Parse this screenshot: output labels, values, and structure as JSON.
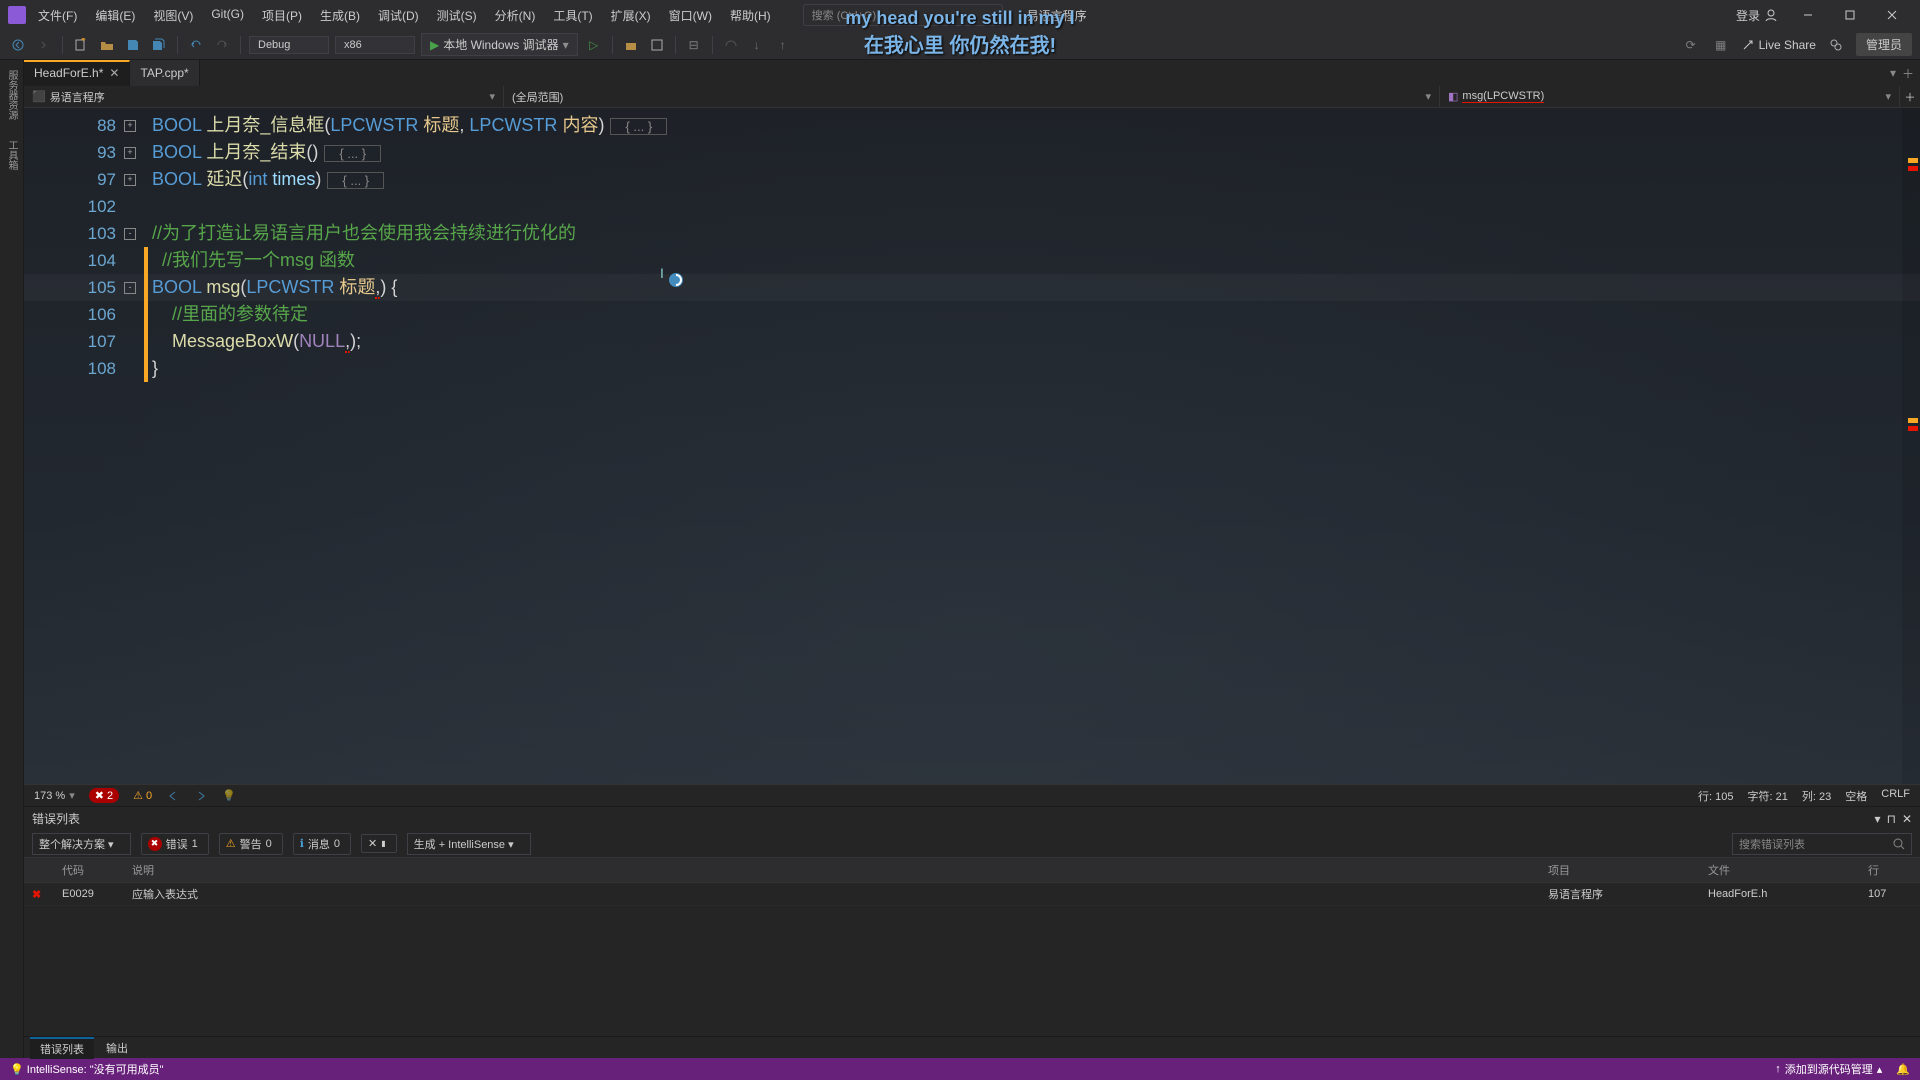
{
  "titlebar": {
    "menus": [
      "文件(F)",
      "编辑(E)",
      "视图(V)",
      "Git(G)",
      "项目(P)",
      "生成(B)",
      "调试(D)",
      "测试(S)",
      "分析(N)",
      "工具(T)",
      "扩展(X)",
      "窗口(W)",
      "帮助(H)"
    ],
    "search_placeholder": "搜索 (Ctrl+Q)",
    "project": "易语言程序",
    "login": "登录",
    "admin": "管理员"
  },
  "lyrics": {
    "en": "my head you're still in my l",
    "cn": "在我心里 你仍然在我!"
  },
  "toolbar": {
    "config": "Debug",
    "platform": "x86",
    "run": "本地 Windows 调试器",
    "liveshare": "Live Share"
  },
  "tabs": [
    {
      "name": "HeadForE.h*",
      "active": true
    },
    {
      "name": "TAP.cpp*",
      "active": false
    }
  ],
  "navbar": {
    "scope_icon": "cpp",
    "scope_left": "易语言程序",
    "scope_center": "(全局范围)",
    "scope_right": "msg(LPCWSTR)"
  },
  "code_lines": [
    {
      "n": 88,
      "fold": "+",
      "bar": "",
      "tokens": [
        [
          "k-type",
          "BOOL "
        ],
        [
          "k-func",
          "上月奈_信息框"
        ],
        [
          "k-punct",
          "("
        ],
        [
          "k-keyword",
          "LPCWSTR"
        ],
        [
          "k-title",
          " 标题"
        ],
        [
          "k-punct",
          ", "
        ],
        [
          "k-keyword",
          "LPCWSTR"
        ],
        [
          "k-title",
          " 内容"
        ],
        [
          "k-punct",
          ")"
        ]
      ],
      "ellipsis": true
    },
    {
      "n": 93,
      "fold": "+",
      "bar": "",
      "tokens": [
        [
          "k-type",
          "BOOL "
        ],
        [
          "k-func",
          "上月奈_结束"
        ],
        [
          "k-punct",
          "()"
        ]
      ],
      "ellipsis": true
    },
    {
      "n": 97,
      "fold": "+",
      "bar": "",
      "tokens": [
        [
          "k-type",
          "BOOL "
        ],
        [
          "k-func",
          "延迟"
        ],
        [
          "k-punct",
          "("
        ],
        [
          "k-keyword",
          "int"
        ],
        [
          "k-param",
          " times"
        ],
        [
          "k-punct",
          ")"
        ]
      ],
      "ellipsis": true
    },
    {
      "n": 102,
      "fold": "",
      "bar": "",
      "tokens": []
    },
    {
      "n": 103,
      "fold": "-",
      "bar": "",
      "tokens": [
        [
          "k-comment",
          "//为了打造让易语言用户也会使用我会持续进行优化的"
        ]
      ]
    },
    {
      "n": 104,
      "fold": "",
      "bar": "mod",
      "tokens": [
        [
          "",
          "  "
        ],
        [
          "k-comment",
          "//我们先写一个msg 函数"
        ]
      ]
    },
    {
      "n": 105,
      "fold": "-",
      "bar": "mod",
      "hl": true,
      "tokens": [
        [
          "k-type",
          "BOOL "
        ],
        [
          "k-func",
          "msg"
        ],
        [
          "k-punct",
          "("
        ],
        [
          "k-keyword",
          "LPCWSTR"
        ],
        [
          "k-title",
          " 标题"
        ],
        [
          "k-punct redwave",
          ","
        ],
        [
          "k-punct",
          ") {"
        ]
      ]
    },
    {
      "n": 106,
      "fold": "",
      "bar": "mod",
      "tokens": [
        [
          "",
          "    "
        ],
        [
          "k-comment",
          "//里面的参数待定"
        ]
      ]
    },
    {
      "n": 107,
      "fold": "",
      "bar": "mod",
      "tokens": [
        [
          "",
          "    "
        ],
        [
          "k-func",
          "MessageBoxW"
        ],
        [
          "k-punct",
          "("
        ],
        [
          "k-null",
          "NULL"
        ],
        [
          "k-punct redwave",
          ","
        ],
        [
          "k-punct",
          ");"
        ]
      ]
    },
    {
      "n": 108,
      "fold": "",
      "bar": "mod",
      "tokens": [
        [
          "k-punct",
          "}"
        ]
      ]
    }
  ],
  "editor_status": {
    "zoom": "173 %",
    "errors": "2",
    "warnings": "0",
    "ln_label": "行:",
    "ln": "105",
    "ch_label": "字符:",
    "ch": "21",
    "col_label": "列:",
    "col": "23",
    "tabs": "空格",
    "eol": "CRLF"
  },
  "error_list": {
    "title": "错误列表",
    "scope": "整个解决方案",
    "err_label": "错误",
    "err_count": "1",
    "warn_label": "警告",
    "warn_count": "0",
    "msg_label": "消息",
    "msg_count": "0",
    "build_mode": "生成 + IntelliSense",
    "search_placeholder": "搜索错误列表",
    "columns": {
      "code": "代码",
      "desc": "说明",
      "project": "项目",
      "file": "文件",
      "line": "行"
    },
    "rows": [
      {
        "icon": "✖",
        "code": "E0029",
        "desc": "应输入表达式",
        "project": "易语言程序",
        "file": "HeadForE.h",
        "line": "107"
      }
    ]
  },
  "bottom_tabs": [
    "错误列表",
    "输出"
  ],
  "statusbar": {
    "intellisense": "IntelliSense: \"没有可用成员\"",
    "source_control": "添加到源代码管理"
  }
}
